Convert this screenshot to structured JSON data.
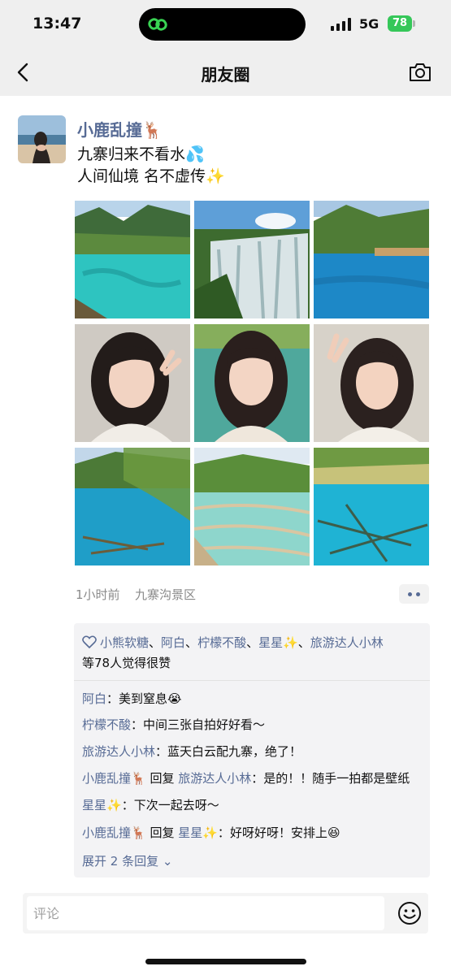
{
  "status_bar": {
    "time": "13:47",
    "network": "5G",
    "battery": "78"
  },
  "nav": {
    "title": "朋友圈",
    "back_icon": "chevron-left-icon",
    "camera_icon": "camera-icon"
  },
  "post": {
    "author": "小鹿乱撞🦌",
    "lines": [
      "九寨归来不看水💦",
      "人间仙境 名不虚传✨"
    ],
    "photos": [
      {
        "kind": "lake-turquoise"
      },
      {
        "kind": "waterfall"
      },
      {
        "kind": "lake-blue"
      },
      {
        "kind": "selfie"
      },
      {
        "kind": "selfie"
      },
      {
        "kind": "selfie"
      },
      {
        "kind": "lake-trees"
      },
      {
        "kind": "terraces"
      },
      {
        "kind": "lake-logs"
      }
    ],
    "time": "1小时前",
    "location": "九寨沟景区"
  },
  "likes": {
    "names": [
      "小熊软糖",
      "阿白",
      "柠檬不酸",
      "星星✨",
      "旅游达人小林"
    ],
    "separator": "、",
    "suffix": "等78人觉得很赞"
  },
  "comments": [
    {
      "name": "阿白",
      "sep": "：",
      "text": "美到窒息😭"
    },
    {
      "name": "柠檬不酸",
      "sep": "：",
      "text": "中间三张自拍好好看～"
    },
    {
      "name": "旅游达人小林",
      "sep": "：",
      "text": "蓝天白云配九寨，绝了！"
    },
    {
      "name": "小鹿乱撞🦌",
      "reply_word": " 回复 ",
      "reply_to": "旅游达人小林",
      "sep": "：",
      "text": "是的！！随手一拍都是壁纸"
    },
    {
      "name": "星星✨",
      "sep": "：",
      "text": "下次一起去呀～"
    },
    {
      "name": "小鹿乱撞🦌",
      "reply_word": " 回复 ",
      "reply_to": "星星✨",
      "sep": "：",
      "text": "好呀好呀！安排上😆"
    }
  ],
  "expand": "展开 2 条回复 ⌄",
  "input": {
    "placeholder": "评论"
  },
  "colors": {
    "link": "#576b95",
    "nav_bg": "#efefef",
    "battery": "#35c759"
  }
}
